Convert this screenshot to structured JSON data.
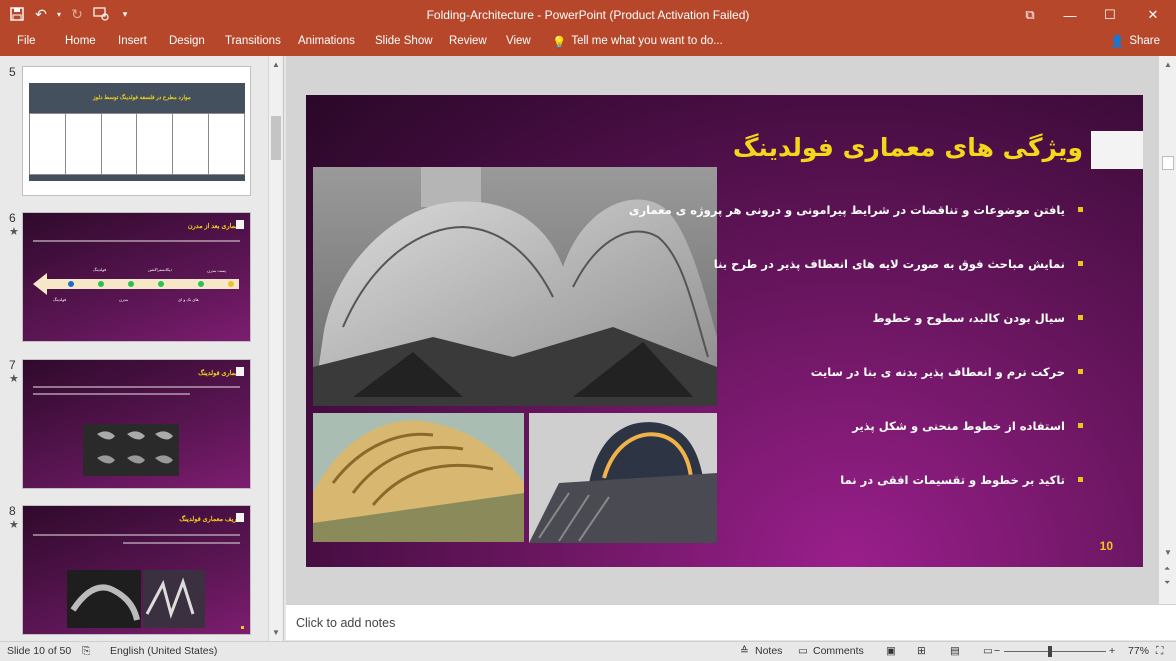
{
  "window": {
    "title": "Folding-Architecture - PowerPoint (Product Activation Failed)",
    "controls": [
      "⧉",
      "—",
      "☐",
      "✕"
    ]
  },
  "quick_access": [
    "save",
    "undo",
    "undo-dropdown",
    "redo",
    "start-from-beginning",
    "customize"
  ],
  "ribbon": {
    "tabs": [
      "File",
      "Home",
      "Insert",
      "Design",
      "Transitions",
      "Animations",
      "Slide Show",
      "Review",
      "View"
    ],
    "tell_me": "Tell me what you want to do...",
    "share": "Share"
  },
  "thumbnails": [
    {
      "number": "5",
      "star": "",
      "title": "موارد مطرح در فلسفه فولدینگ توسط دلوز"
    },
    {
      "number": "6",
      "star": "★",
      "title": "معماری بعد از مدرن",
      "labels": [
        "پست مدرن",
        "فولدینگ",
        "دیکانستراکشن",
        "فولدینگ",
        "مدرن",
        "های تک و ای",
        "مینیمال",
        "دیکانستراکشن"
      ]
    },
    {
      "number": "7",
      "star": "★",
      "title": "معماری فولدینگ"
    },
    {
      "number": "8",
      "star": "★",
      "title": "تعریف معماری فولدینگ"
    }
  ],
  "slide": {
    "title": "ویژگی های معماری فولدینگ",
    "bullets": [
      "یافتن موضوعات و تناقضات در شرایط پیرامونی و درونی هر پروژه ی معماری",
      "نمایش مباحث فوق به صورت لایه های انعطاف پذیر در طرح بنا",
      "سیال بودن کالبد، سطوح و خطوط",
      "حرکت نرم و انعطاف پذیر بدنه ی بنا در سایت",
      "استفاده از خطوط منحنی و شکل پذیر",
      "تاکید بر خطوط و تقسیمات افقی در نما"
    ],
    "number": "10"
  },
  "notes": {
    "placeholder": "Click to add notes"
  },
  "status": {
    "slide_info": "Slide 10 of 50",
    "language": "English (United States)",
    "notes": "Notes",
    "comments": "Comments",
    "zoom_minus": "−",
    "zoom_plus": "+",
    "zoom": "77%"
  },
  "colors": {
    "ribbon": "#b7472a",
    "slide_bg": "#5a1553",
    "title_yellow": "#f4d71b"
  }
}
